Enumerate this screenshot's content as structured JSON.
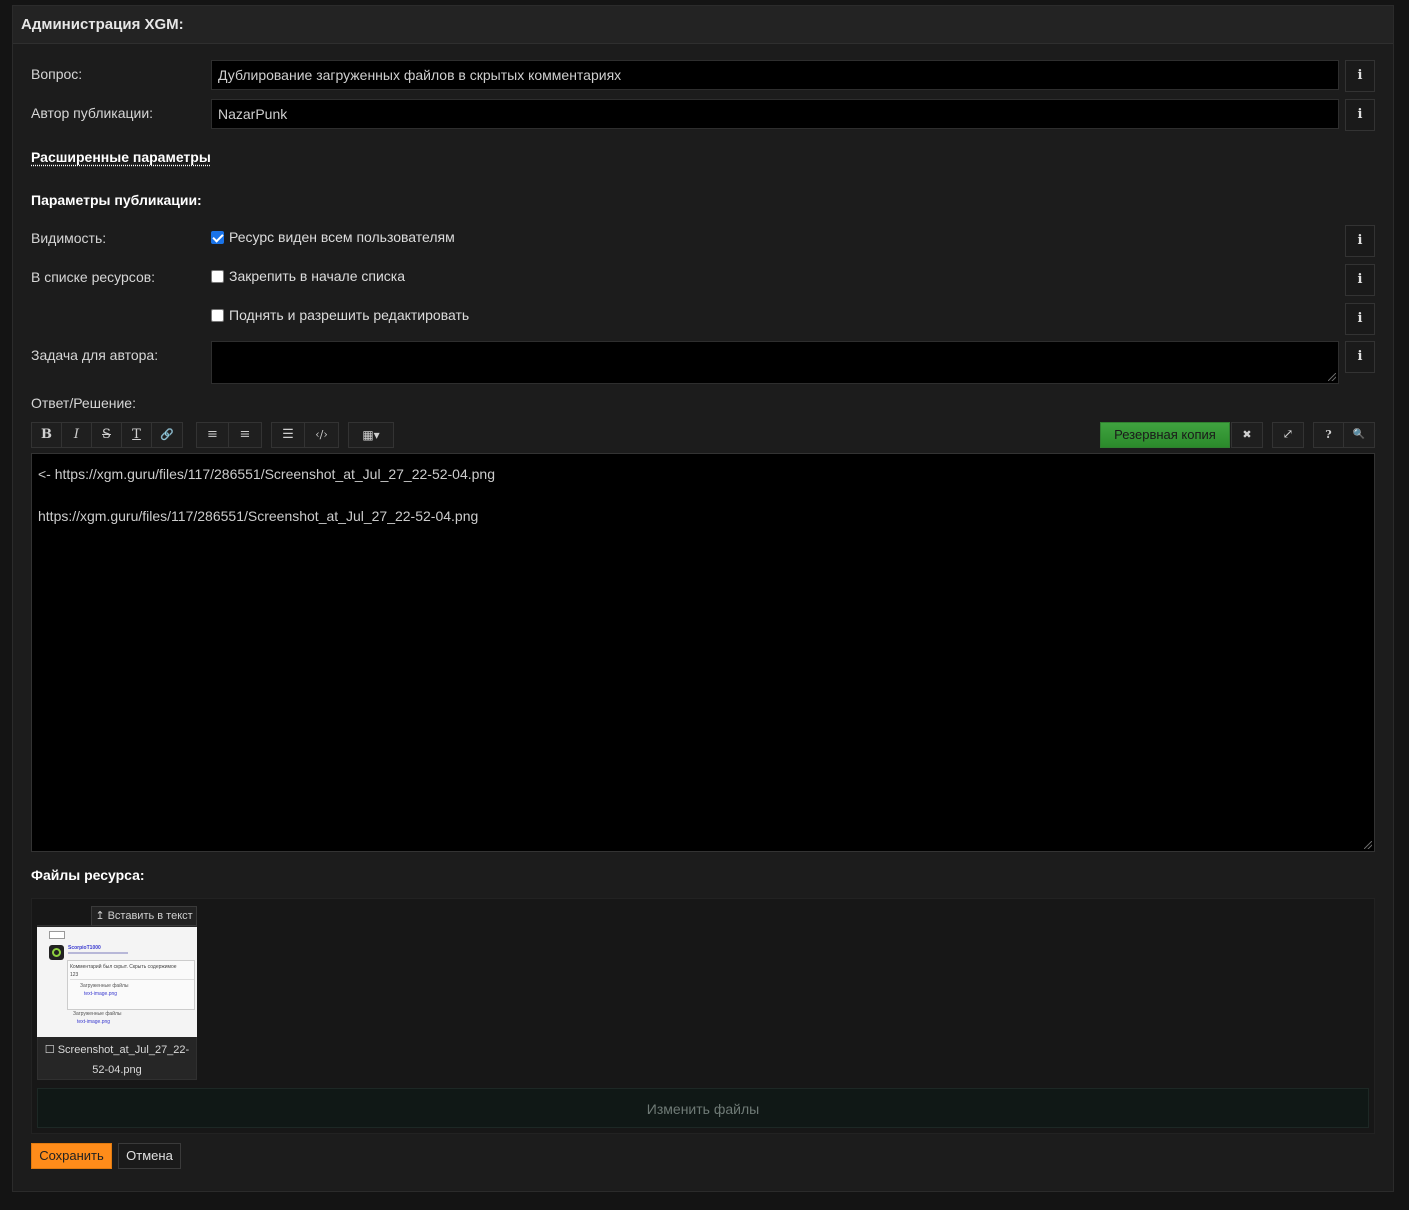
{
  "header": {
    "title": "Администрация XGM:"
  },
  "form": {
    "question_label": "Вопрос:",
    "question_value": "Дублирование загруженных файлов в скрытых комментариях",
    "author_label": "Автор публикации:",
    "author_value": "NazarPunk",
    "advanced_link": "Расширенные параметры",
    "pub_params_heading": "Параметры публикации:",
    "visibility_label": "Видимость:",
    "visibility_option": "Ресурс виден всем пользователям",
    "visibility_checked": true,
    "list_label": "В списке ресурсов:",
    "pin_option": "Закрепить в начале списка",
    "pin_checked": false,
    "raise_option": "Поднять и разрешить редактировать",
    "raise_checked": false,
    "task_label": "Задача для автора:",
    "task_value": "",
    "answer_label": "Ответ/Решение:",
    "info_symbol": "i"
  },
  "toolbar": {
    "bold": "B",
    "italic": "I",
    "strike": "S",
    "clear": "T",
    "link": "🔗",
    "center": "≡",
    "right": "≡",
    "list": "☰",
    "code": "‹/›",
    "table": "▦▾",
    "backup_label": "Резервная копия",
    "close": "✖",
    "fullscreen": "⤢",
    "help": "?",
    "search": "🔍"
  },
  "editor": {
    "lines": [
      "<- https://xgm.guru/files/117/286551/Screenshot_at_Jul_27_22-52-04.png",
      "",
      "https://xgm.guru/files/117/286551/Screenshot_at_Jul_27_22-52-04.png"
    ]
  },
  "files": {
    "heading": "Файлы ресурса:",
    "insert_label": "↥ Вставить в текст",
    "items": [
      {
        "name": "☐ Screenshot_at_Jul_27_22-52-04.png"
      }
    ],
    "change_files_label": "Изменить файлы"
  },
  "thumb": {
    "user": "ScorpioT1000",
    "line1": "Комментарий был скрыт. Скрыть содержимое",
    "line2": "123",
    "line3": "Загруженные файлы",
    "line4": "text-image.png",
    "line5": "Загруженные файлы",
    "line6": "text-image.png"
  },
  "actions": {
    "save_label": "Сохранить",
    "cancel_label": "Отмена"
  }
}
